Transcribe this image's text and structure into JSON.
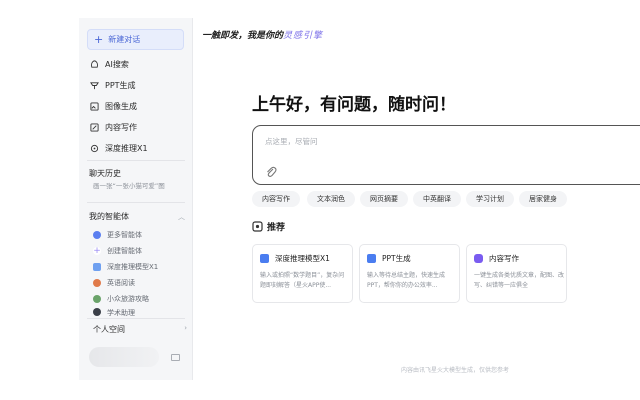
{
  "sidebar": {
    "new_chat": "新建对话",
    "nav": [
      {
        "label": "AI搜索",
        "icon": "search-icon"
      },
      {
        "label": "PPT生成",
        "icon": "ppt-icon"
      },
      {
        "label": "图像生成",
        "icon": "image-icon"
      },
      {
        "label": "内容写作",
        "icon": "pen-icon"
      },
      {
        "label": "深度推理X1",
        "icon": "atom-icon"
      }
    ],
    "history_title": "聊天历史",
    "history_items": [
      "画一张“一张小猫可爱”图"
    ],
    "agents_title": "我的智能体",
    "agents": [
      {
        "label": "更多智能体",
        "color": "#5b7ff0"
      },
      {
        "label": "创建智能体",
        "color": "#9b8cf5"
      },
      {
        "label": "深度推理模型X1",
        "color": "#6fa0f0"
      },
      {
        "label": "英语阅读",
        "color": "#e07a4a"
      },
      {
        "label": "小众旅游攻略",
        "color": "#6aa36a"
      },
      {
        "label": "学术助理",
        "color": "#3a3f48"
      }
    ],
    "personal_title": "个人空间"
  },
  "main": {
    "slogan_prefix": "一触即发，我是你的",
    "slogan_accent": "灵感引擎",
    "greeting": "上午好，有问题，随时问！",
    "input_placeholder": "点这里，尽管问",
    "chips": [
      "内容写作",
      "文本润色",
      "网页摘要",
      "中英翻译",
      "学习计划",
      "居家健身"
    ],
    "recommend_title": "推荐",
    "cards": [
      {
        "title": "深度推理模型X1",
        "desc": "输入或拍照“数学题目”，复杂问题即刻解答（星火APP使...",
        "color": "#4a7df0"
      },
      {
        "title": "PPT生成",
        "desc": "输入等待总结主题，快速生成 PPT，帮你你的办公效率...",
        "color": "#4a7df0"
      },
      {
        "title": "内容写作",
        "desc": "一键生成各类优质文章，配图、改写、纠错等一应俱全",
        "color": "#7a5cf0"
      }
    ],
    "footer_note": "内容由讯飞星火大模型生成，仅供您参考"
  }
}
